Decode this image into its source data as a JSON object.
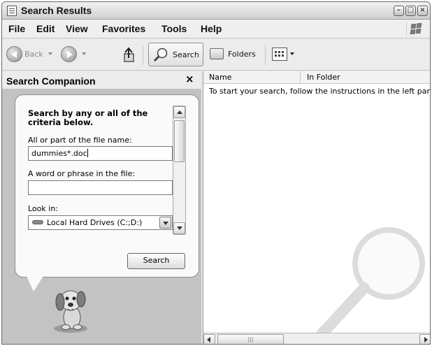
{
  "window": {
    "title": "Search Results"
  },
  "menu": [
    "File",
    "Edit",
    "View",
    "Favorites",
    "Tools",
    "Help"
  ],
  "toolbar": {
    "back_label": "Back",
    "search_label": "Search",
    "folders_label": "Folders"
  },
  "companion": {
    "title": "Search Companion",
    "close": "×",
    "heading": "Search by any or all of the criteria below.",
    "filename_label": "All or part of the file name:",
    "filename_value": "dummies*.doc",
    "phrase_label": "A word or phrase in the file:",
    "phrase_value": "",
    "lookin_label": "Look in:",
    "lookin_value": "Local Hard Drives (C:;D:)",
    "search_button": "Search"
  },
  "results": {
    "columns": [
      "Name",
      "In Folder"
    ],
    "hint": "To start your search, follow the instructions in the left pane"
  },
  "icons": {
    "window": "search-window-icon",
    "back": "back-arrow-icon",
    "forward": "forward-arrow-icon",
    "up": "folder-up-icon",
    "search": "magnifier-icon",
    "folders": "folders-icon",
    "views": "views-icon",
    "drive": "hard-drive-icon",
    "mascot": "search-dog-icon"
  }
}
